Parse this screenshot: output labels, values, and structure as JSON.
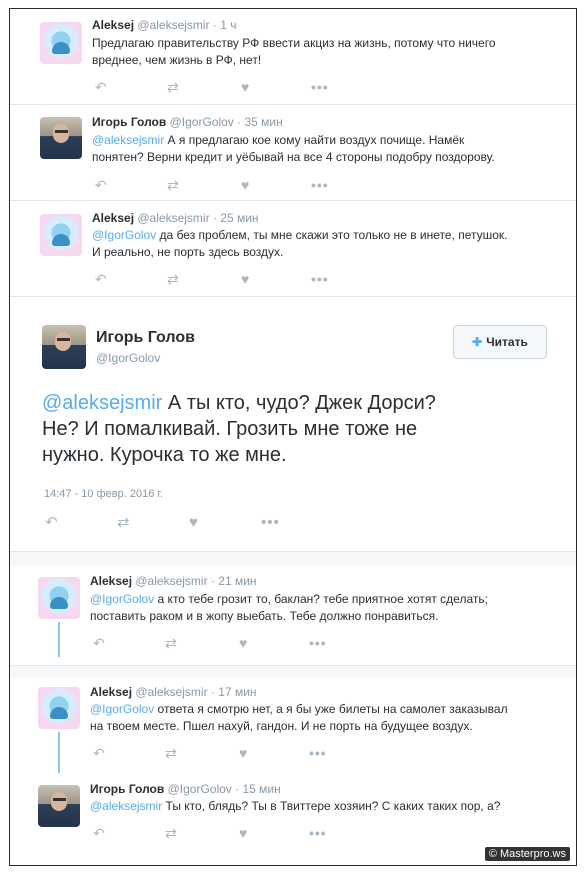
{
  "tweets": [
    {
      "name": "Aleksej",
      "handle": "@aleksejsmir",
      "dot": "·",
      "time": "1 ч",
      "text_line1": "Предлагаю правительству РФ ввести акциз на жизнь, потому что ничего",
      "text_line2": "вреднее, чем жизнь в РФ, нет!"
    },
    {
      "name": "Игорь Голов",
      "handle": "@IgorGolov",
      "dot": "·",
      "time": "35 мин",
      "mention": "@aleksejsmir",
      "text_line1": " А я предлагаю кое кому найти воздух почище. Намёк",
      "text_line2": "понятен? Верни кредит и уёбывай на все 4 стороны подобру поздорову."
    },
    {
      "name": "Aleksej",
      "handle": "@aleksejsmir",
      "dot": "·",
      "time": "25 мин",
      "mention": "@IgorGolov",
      "text_line1": " да без проблем, ты мне скажи это только не в инете, петушок.",
      "text_line2": "И реально, не порть здесь воздух."
    },
    {
      "name": "Aleksej",
      "handle": "@aleksejsmir",
      "dot": "·",
      "time": "21 мин",
      "mention": "@IgorGolov",
      "text_line1": " а кто тебе грозит то, баклан? тебе приятное хотят сделать;",
      "text_line2": "поставить раком и в жопу выебать. Тебе должно понравиться."
    },
    {
      "name": "Aleksej",
      "handle": "@aleksejsmir",
      "dot": "·",
      "time": "17 мин",
      "mention": "@IgorGolov",
      "text_line1": " ответа я смотрю нет, а я бы уже билеты на самолет заказывал",
      "text_line2": "на твоем месте. Пшел нахуй, гандон. И не порть на будущее воздух."
    },
    {
      "name": "Игорь Голов",
      "handle": "@IgorGolov",
      "dot": "·",
      "time": "15 мин",
      "mention": "@aleksejsmir",
      "text_line1": " Ты кто, блядь? Ты в Твиттере хозяин? С каких таких пор, а?"
    }
  ],
  "main_tweet": {
    "name": "Игорь Голов",
    "handle": "@IgorGolov",
    "follow_label": "Читать",
    "mention": "@aleksejsmir",
    "text_line1": " А ты кто, чудо? Джек Дорси?",
    "text_line2": "Не? И помалкивай. Грозить мне тоже не",
    "text_line3": "нужно. Курочка то же мне.",
    "timestamp": "14:47 - 10 февр. 2016 г."
  },
  "icons": {
    "reply": "↶",
    "retweet": "⇄",
    "like": "♥",
    "more": "•••",
    "follow": "person-plus-icon"
  },
  "watermark": "© Masterpro.ws",
  "colors": {
    "link": "#55acee",
    "muted": "#8899a6",
    "icon": "#aab8c2"
  }
}
